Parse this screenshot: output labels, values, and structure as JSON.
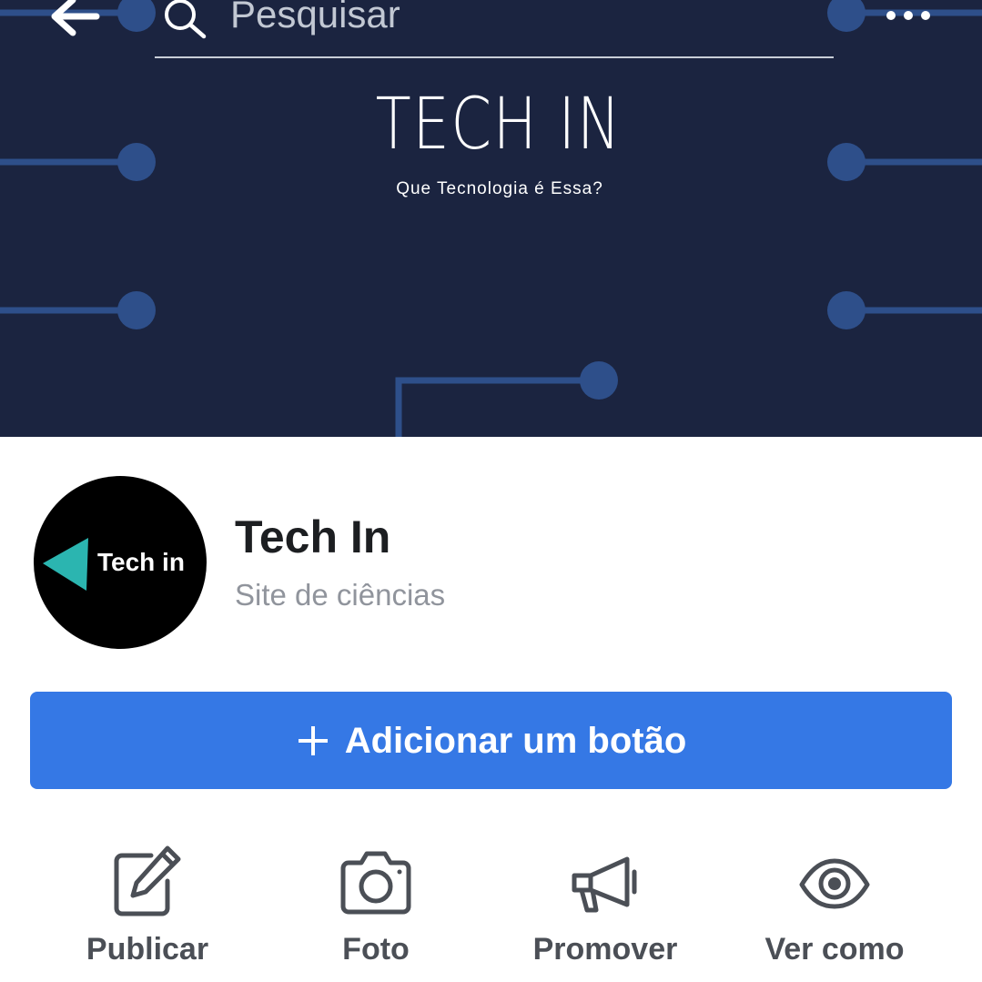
{
  "cover": {
    "search_placeholder": "Pesquisar",
    "brand_title": "TECH IN",
    "brand_subtitle": "Que Tecnologia é Essa?",
    "colors": {
      "background": "#1b2440",
      "circuit": "#2e4f8a"
    }
  },
  "topbar": {
    "back_icon": "arrow-left-icon",
    "search_icon": "search-icon",
    "more_icon": "more-dots-icon"
  },
  "profile": {
    "avatar_text": "Tech in",
    "avatar_accent": "#2bb5b0",
    "name": "Tech In",
    "category": "Site de ciências"
  },
  "primary_action": {
    "label": "Adicionar um botão",
    "icon": "plus-icon",
    "color": "#3578e5"
  },
  "actions": [
    {
      "label": "Publicar",
      "icon": "edit-icon"
    },
    {
      "label": "Foto",
      "icon": "camera-icon"
    },
    {
      "label": "Promover",
      "icon": "megaphone-icon"
    },
    {
      "label": "Ver como",
      "icon": "eye-icon"
    }
  ]
}
